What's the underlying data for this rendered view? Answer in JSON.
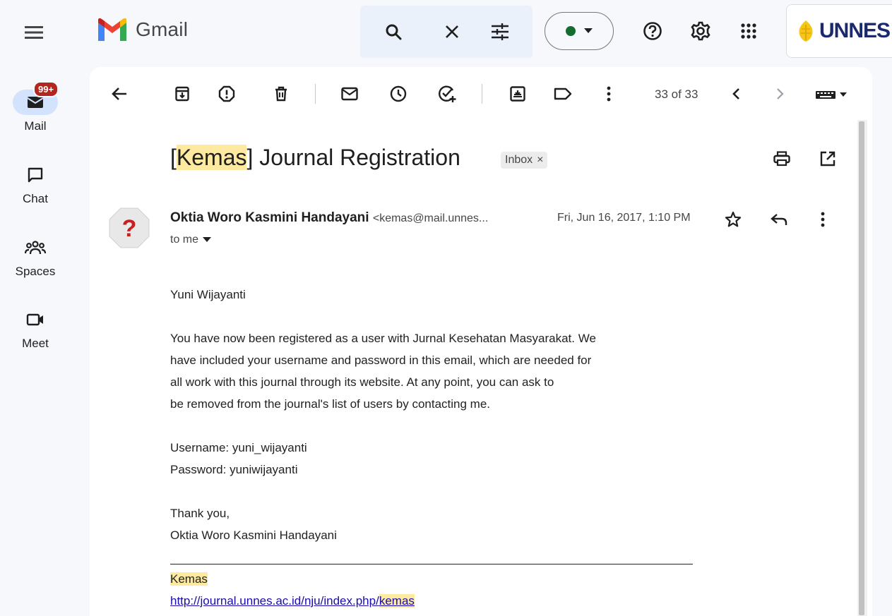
{
  "app": {
    "name": "Gmail",
    "brand_colors": {
      "red": "#ea4335",
      "blue": "#4285f4",
      "green": "#34a853",
      "yellow": "#fbbc04"
    }
  },
  "topbar": {
    "menu_icon": "hamburger-icon",
    "search_icons": [
      "search-icon",
      "clear-icon",
      "filter-options-icon"
    ],
    "status_color": "#146c2e",
    "help_icon": "help-icon",
    "settings_icon": "gear-icon",
    "apps_icon": "apps-grid-icon",
    "account_logo_text": "UNNES"
  },
  "rail": {
    "items": [
      {
        "label": "Mail",
        "icon": "mail-icon",
        "active": true,
        "badge": "99+"
      },
      {
        "label": "Chat",
        "icon": "chat-icon",
        "active": false
      },
      {
        "label": "Spaces",
        "icon": "spaces-icon",
        "active": false
      },
      {
        "label": "Meet",
        "icon": "video-icon",
        "active": false
      }
    ]
  },
  "toolbar": {
    "pager": "33 of 33",
    "icons": [
      "back-arrow-icon",
      "archive-icon",
      "report-spam-icon",
      "delete-icon",
      "mark-unread-icon",
      "snooze-icon",
      "add-task-icon",
      "move-to-icon",
      "label-icon",
      "more-vert-icon",
      "prev-icon",
      "next-icon",
      "keyboard-icon"
    ]
  },
  "email": {
    "subject_highlight": "Kemas",
    "subject_rest": "Journal Registration",
    "subject_open_bracket": "[",
    "subject_close_bracket": "]",
    "label_chip": "Inbox",
    "label_chip_close": "×",
    "sender_name": "Oktia Woro Kasmini Handayani",
    "sender_email": "<kemas@mail.unnes...",
    "date": "Fri, Jun 16, 2017, 1:10 PM",
    "recipient": "to me",
    "greeting": "Yuni Wijayanti",
    "paragraph_lines": [
      "You have now been registered as a user with Jurnal Kesehatan Masyarakat. We",
      "have included your username and password in this email, which are needed for",
      "all work with this journal through its website. At any point, you can ask to",
      "be removed from the journal's list of users by contacting me."
    ],
    "username_line": "Username: yuni_wijayanti",
    "password_line": "Password: yuniwijayanti",
    "closing": "Thank you,",
    "closing_name": "Oktia Woro Kasmini Handayani",
    "signature_name": "Kemas",
    "signature_link_prefix": "http://journal.unnes.ac.id/nju/index.php/",
    "signature_link_highlight": "kemas"
  }
}
